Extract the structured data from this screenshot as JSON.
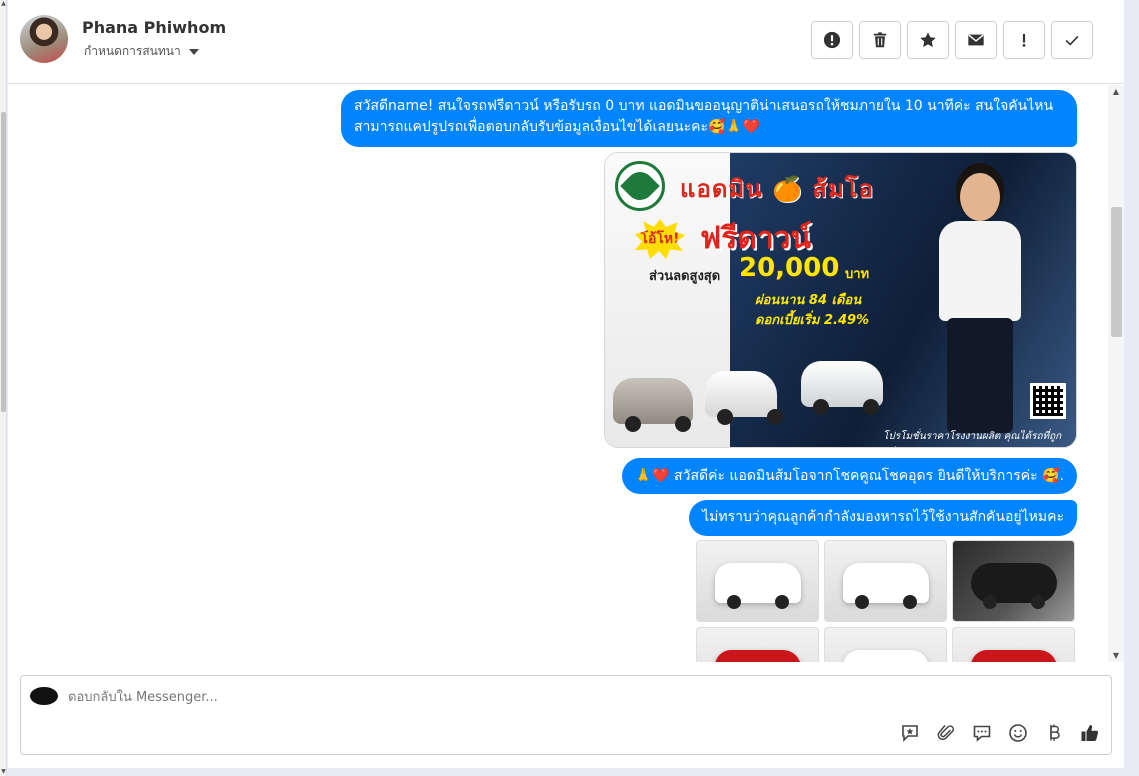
{
  "header": {
    "contact_name": "Phana Phiwhom",
    "assign_label": "กำหนดการสนทนา"
  },
  "actions": [
    {
      "name": "mark-spam",
      "icon": "alert-circle-icon"
    },
    {
      "name": "delete",
      "icon": "trash-icon"
    },
    {
      "name": "star",
      "icon": "star-icon"
    },
    {
      "name": "mark-unread",
      "icon": "envelope-icon"
    },
    {
      "name": "follow-up",
      "icon": "exclamation-icon"
    },
    {
      "name": "mark-done",
      "icon": "checkmark-icon"
    }
  ],
  "messages": {
    "greeting": "สวัสดีname! สนใจรถฟรีดาวน์ หรือรับรถ 0 บาท แอดมินขออนุญาติน่าเสนอรถให้ชมภายใน 10 นาทีค่ะ สนใจคันไหนสามารถแคปรูปรถเพื่อตอบกลับรับข้อมูลเงื่อนไขได้เลยนะคะ🥰🙏❤️",
    "welcome": "🙏❤️ สวัสดีค่ะ แอดมินส้มโอจากโชคคูณโชคอุดร ยินดีให้บริการค่ะ  🥰.",
    "question": "ไม่ทราบว่าคุณลูกค้ากำลังมองหารถไว้ใช้งานสักคันอยู่ไหมคะ"
  },
  "promo": {
    "headline": "แอดมิน 🍊 ส้มโอ",
    "badge": "โอ้โห!",
    "title": "ฟรีดาวน์",
    "discount_label": "ส่วนลดสูงสุด",
    "discount_amount": "20,000",
    "currency": "บาท",
    "installment": "ผ่อนนาน 84 เดือน",
    "interest": "ดอกเบี้ยเริ่ม 2.49%",
    "footer": "โปรโมชั่นราคาโรงงานผลิต คุณได้รถที่ถูกกว่า"
  },
  "gallery": [
    {
      "kind": "white-car-front"
    },
    {
      "kind": "white-car-front"
    },
    {
      "kind": "interior"
    },
    {
      "kind": "red-car-rear"
    },
    {
      "kind": "white-car-rear"
    },
    {
      "kind": "red-car-rear"
    }
  ],
  "composer": {
    "placeholder": "ตอบกลับใน Messenger..."
  },
  "composer_tools": [
    "saved-reply-icon",
    "attachment-icon",
    "chat-bubble-icon",
    "emoji-icon",
    "baht-icon",
    "thumbs-up-icon"
  ]
}
